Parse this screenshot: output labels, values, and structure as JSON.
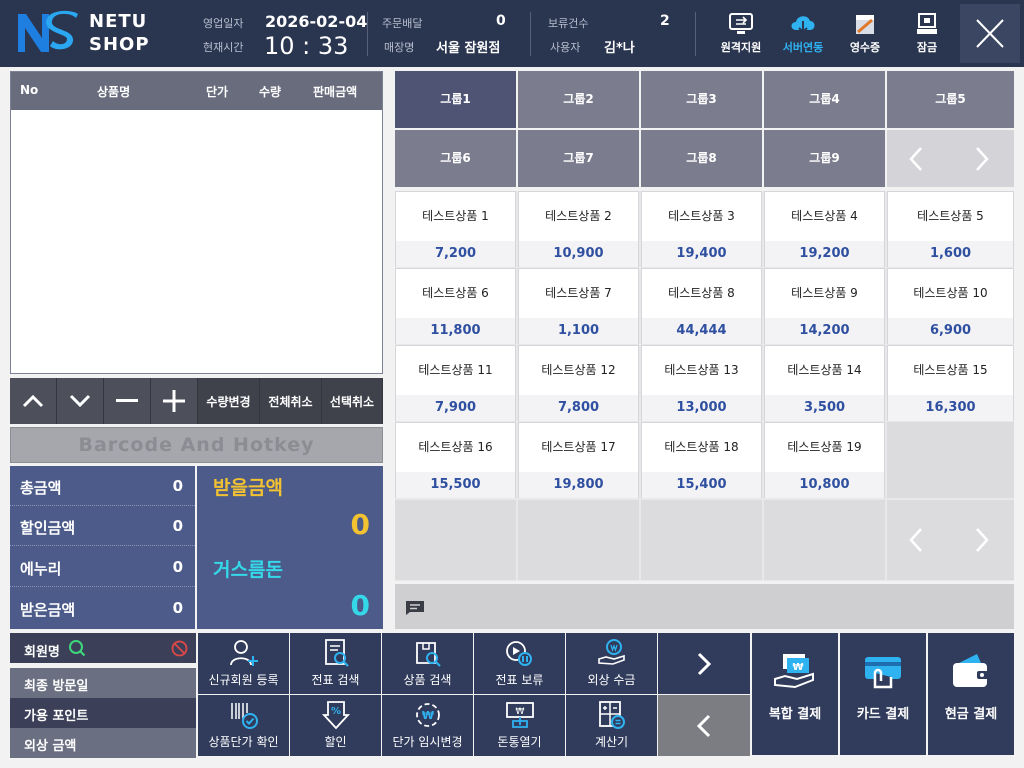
{
  "header": {
    "logo_top": "NETU",
    "logo_bottom": "SHOP",
    "business_date_label": "영업일자",
    "business_date": "2026-02-04",
    "current_time_label": "현재시간",
    "current_time": "10 : 33",
    "order_delivery_label": "주문배달",
    "order_delivery_count": "0",
    "store_label": "매장명",
    "store_name": "서울 잠원점",
    "hold_count_label": "보류건수",
    "hold_count": "2",
    "user_label": "사용자",
    "user_name": "김*나",
    "buttons": [
      {
        "label": "원격지원",
        "icon": "remote-support-icon"
      },
      {
        "label": "서버연동",
        "icon": "cloud-sync-icon"
      },
      {
        "label": "영수증",
        "icon": "receipt-icon"
      },
      {
        "label": "잠금",
        "icon": "lock-icon"
      }
    ],
    "close_icon": "close-icon"
  },
  "cart": {
    "columns": [
      "No",
      "상품명",
      "단가",
      "수량",
      "판매금액"
    ],
    "rows": []
  },
  "controls": {
    "up_icon": "chevron-up-icon",
    "down_icon": "chevron-down-icon",
    "minus_icon": "minus-icon",
    "plus_icon": "plus-icon",
    "qty_change": "수량변경",
    "cancel_all": "전체취소",
    "cancel_selected": "선택취소"
  },
  "barcode_placeholder": "Barcode And Hotkey",
  "summary": {
    "total_label": "총금액",
    "total": "0",
    "discount_label": "할인금액",
    "discount": "0",
    "eneuri_label": "에누리",
    "eneuri": "0",
    "received_label": "받은금액",
    "received": "0",
    "to_receive_label": "받을금액",
    "to_receive": "0",
    "change_label": "거스름돈",
    "change": "0"
  },
  "groups": [
    "그룹1",
    "그룹2",
    "그룹3",
    "그룹4",
    "그룹5",
    "그룹6",
    "그룹7",
    "그룹8",
    "그룹9"
  ],
  "products": [
    {
      "name": "테스트상품 1",
      "price": "7,200"
    },
    {
      "name": "테스트상품 2",
      "price": "10,900"
    },
    {
      "name": "테스트상품 3",
      "price": "19,400"
    },
    {
      "name": "테스트상품 4",
      "price": "19,200"
    },
    {
      "name": "테스트상품 5",
      "price": "1,600"
    },
    {
      "name": "테스트상품 6",
      "price": "11,800"
    },
    {
      "name": "테스트상품 7",
      "price": "1,100"
    },
    {
      "name": "테스트상품 8",
      "price": "44,444"
    },
    {
      "name": "테스트상품 9",
      "price": "14,200"
    },
    {
      "name": "테스트상품 10",
      "price": "6,900"
    },
    {
      "name": "테스트상품 11",
      "price": "7,900"
    },
    {
      "name": "테스트상품 12",
      "price": "7,800"
    },
    {
      "name": "테스트상품 13",
      "price": "13,000"
    },
    {
      "name": "테스트상품 14",
      "price": "3,500"
    },
    {
      "name": "테스트상품 15",
      "price": "16,300"
    },
    {
      "name": "테스트상품 16",
      "price": "15,500"
    },
    {
      "name": "테스트상품 17",
      "price": "19,800"
    },
    {
      "name": "테스트상품 18",
      "price": "15,400"
    },
    {
      "name": "테스트상품 19",
      "price": "10,800"
    }
  ],
  "member": {
    "name_label": "회원명",
    "last_visit_label": "최종 방문일",
    "points_label": "가용 포인트",
    "credit_label": "외상 금액"
  },
  "functions": [
    {
      "label": "신규회원 등록",
      "icon": "add-member-icon"
    },
    {
      "label": "전표 검색",
      "icon": "slip-search-icon"
    },
    {
      "label": "상품 검색",
      "icon": "product-search-icon"
    },
    {
      "label": "전표 보류",
      "icon": "slip-hold-icon"
    },
    {
      "label": "외상 수금",
      "icon": "credit-collect-icon"
    },
    {
      "label": "상품단가 확인",
      "icon": "price-check-icon"
    },
    {
      "label": "할인",
      "icon": "discount-icon"
    },
    {
      "label": "단가 임시변경",
      "icon": "temp-price-icon"
    },
    {
      "label": "돈통열기",
      "icon": "cash-drawer-icon"
    },
    {
      "label": "계산기",
      "icon": "calculator-icon"
    }
  ],
  "payments": [
    {
      "label": "복합 결제",
      "icon": "complex-payment-icon"
    },
    {
      "label": "카드 결제",
      "icon": "card-payment-icon"
    },
    {
      "label": "현금 결제",
      "icon": "cash-payment-icon"
    }
  ],
  "colors": {
    "header_bg": "#2a3550",
    "accent_yellow": "#f2c230",
    "accent_cyan": "#35d8e8",
    "price_blue": "#2f4fa0"
  }
}
